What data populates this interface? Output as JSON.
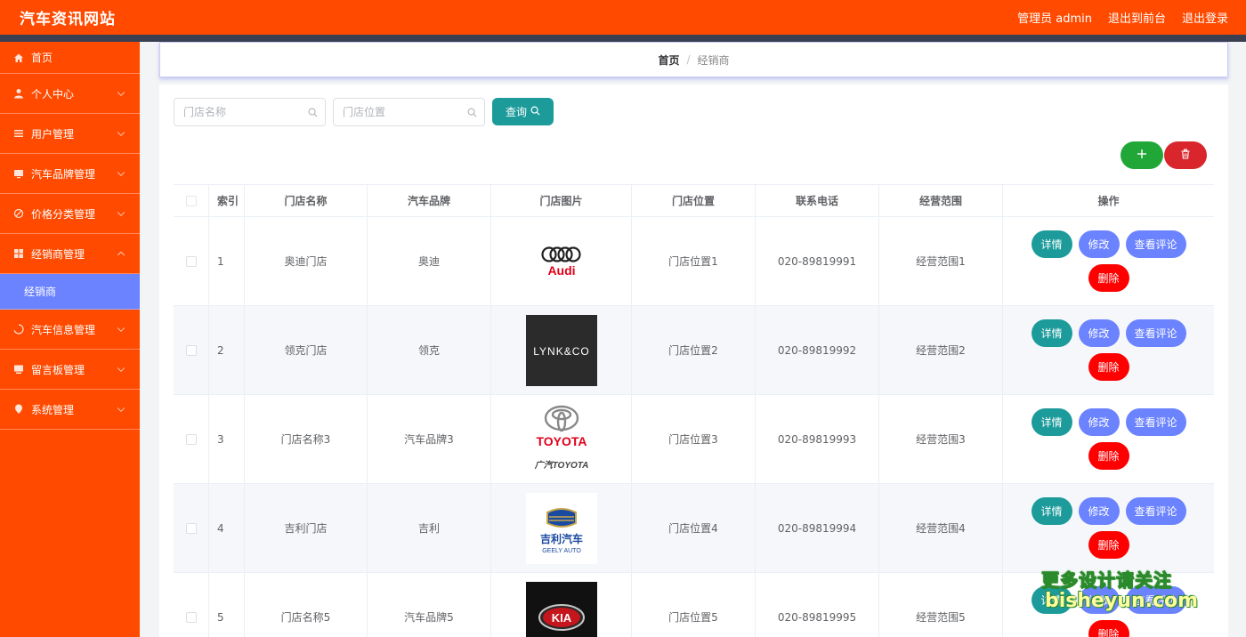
{
  "topbar": {
    "site_title": "汽车资讯网站",
    "admin_label": "管理员 admin",
    "back_front": "退出到前台",
    "logout": "退出登录"
  },
  "sidebar": {
    "items": [
      {
        "label": "首页",
        "icon": "home-icon"
      },
      {
        "label": "个人中心",
        "icon": "user-icon"
      },
      {
        "label": "用户管理",
        "icon": "list-icon"
      },
      {
        "label": "汽车品牌管理",
        "icon": "monitor-icon"
      },
      {
        "label": "价格分类管理",
        "icon": "discount-icon"
      },
      {
        "label": "经销商管理",
        "icon": "grid-icon"
      },
      {
        "label": "汽车信息管理",
        "icon": "loading-icon"
      },
      {
        "label": "留言板管理",
        "icon": "board-icon"
      },
      {
        "label": "系统管理",
        "icon": "location-icon"
      }
    ],
    "active_sub": "经销商"
  },
  "breadcrumb": {
    "home": "首页",
    "sep": "/",
    "current": "经销商"
  },
  "search": {
    "name_placeholder": "门店名称",
    "location_placeholder": "门店位置",
    "query_label": "查询"
  },
  "table": {
    "headers": [
      "索引",
      "门店名称",
      "汽车品牌",
      "门店图片",
      "门店位置",
      "联系电话",
      "经营范围",
      "操作"
    ],
    "rows": [
      {
        "index": "1",
        "name": "奥迪门店",
        "brand": "奥迪",
        "logo": "audi-logo",
        "location": "门店位置1",
        "phone": "020-89819991",
        "scope": "经营范围1"
      },
      {
        "index": "2",
        "name": "领克门店",
        "brand": "领克",
        "logo": "lynkco-logo",
        "location": "门店位置2",
        "phone": "020-89819992",
        "scope": "经营范围2"
      },
      {
        "index": "3",
        "name": "门店名称3",
        "brand": "汽车品牌3",
        "logo": "toyota-logo",
        "location": "门店位置3",
        "phone": "020-89819993",
        "scope": "经营范围3"
      },
      {
        "index": "4",
        "name": "吉利门店",
        "brand": "吉利",
        "logo": "geely-logo",
        "location": "门店位置4",
        "phone": "020-89819994",
        "scope": "经营范围4"
      },
      {
        "index": "5",
        "name": "门店名称5",
        "brand": "汽车品牌5",
        "logo": "kia-logo",
        "location": "门店位置5",
        "phone": "020-89819995",
        "scope": "经营范围5"
      }
    ],
    "actions": {
      "detail": "详情",
      "edit": "修改",
      "review": "查看评论",
      "delete": "删除"
    }
  },
  "logos": {
    "audi_text": "Audi",
    "lynkco_text": "LYNK&CO",
    "toyota_text": "TOYOTA",
    "toyota_sub": "广汽TOYOTA",
    "geely_text": "吉利汽车",
    "geely_sub": "GEELY AUTO",
    "kia_text": "KIA"
  },
  "watermark": {
    "line1": "更多设计请关注",
    "line2": "bisheyun.com"
  },
  "colors": {
    "brand": "#ff4a00",
    "accent_blue": "#6b83ff",
    "teal": "#1d9b9b",
    "danger": "#ff0000",
    "success": "#21a738"
  }
}
